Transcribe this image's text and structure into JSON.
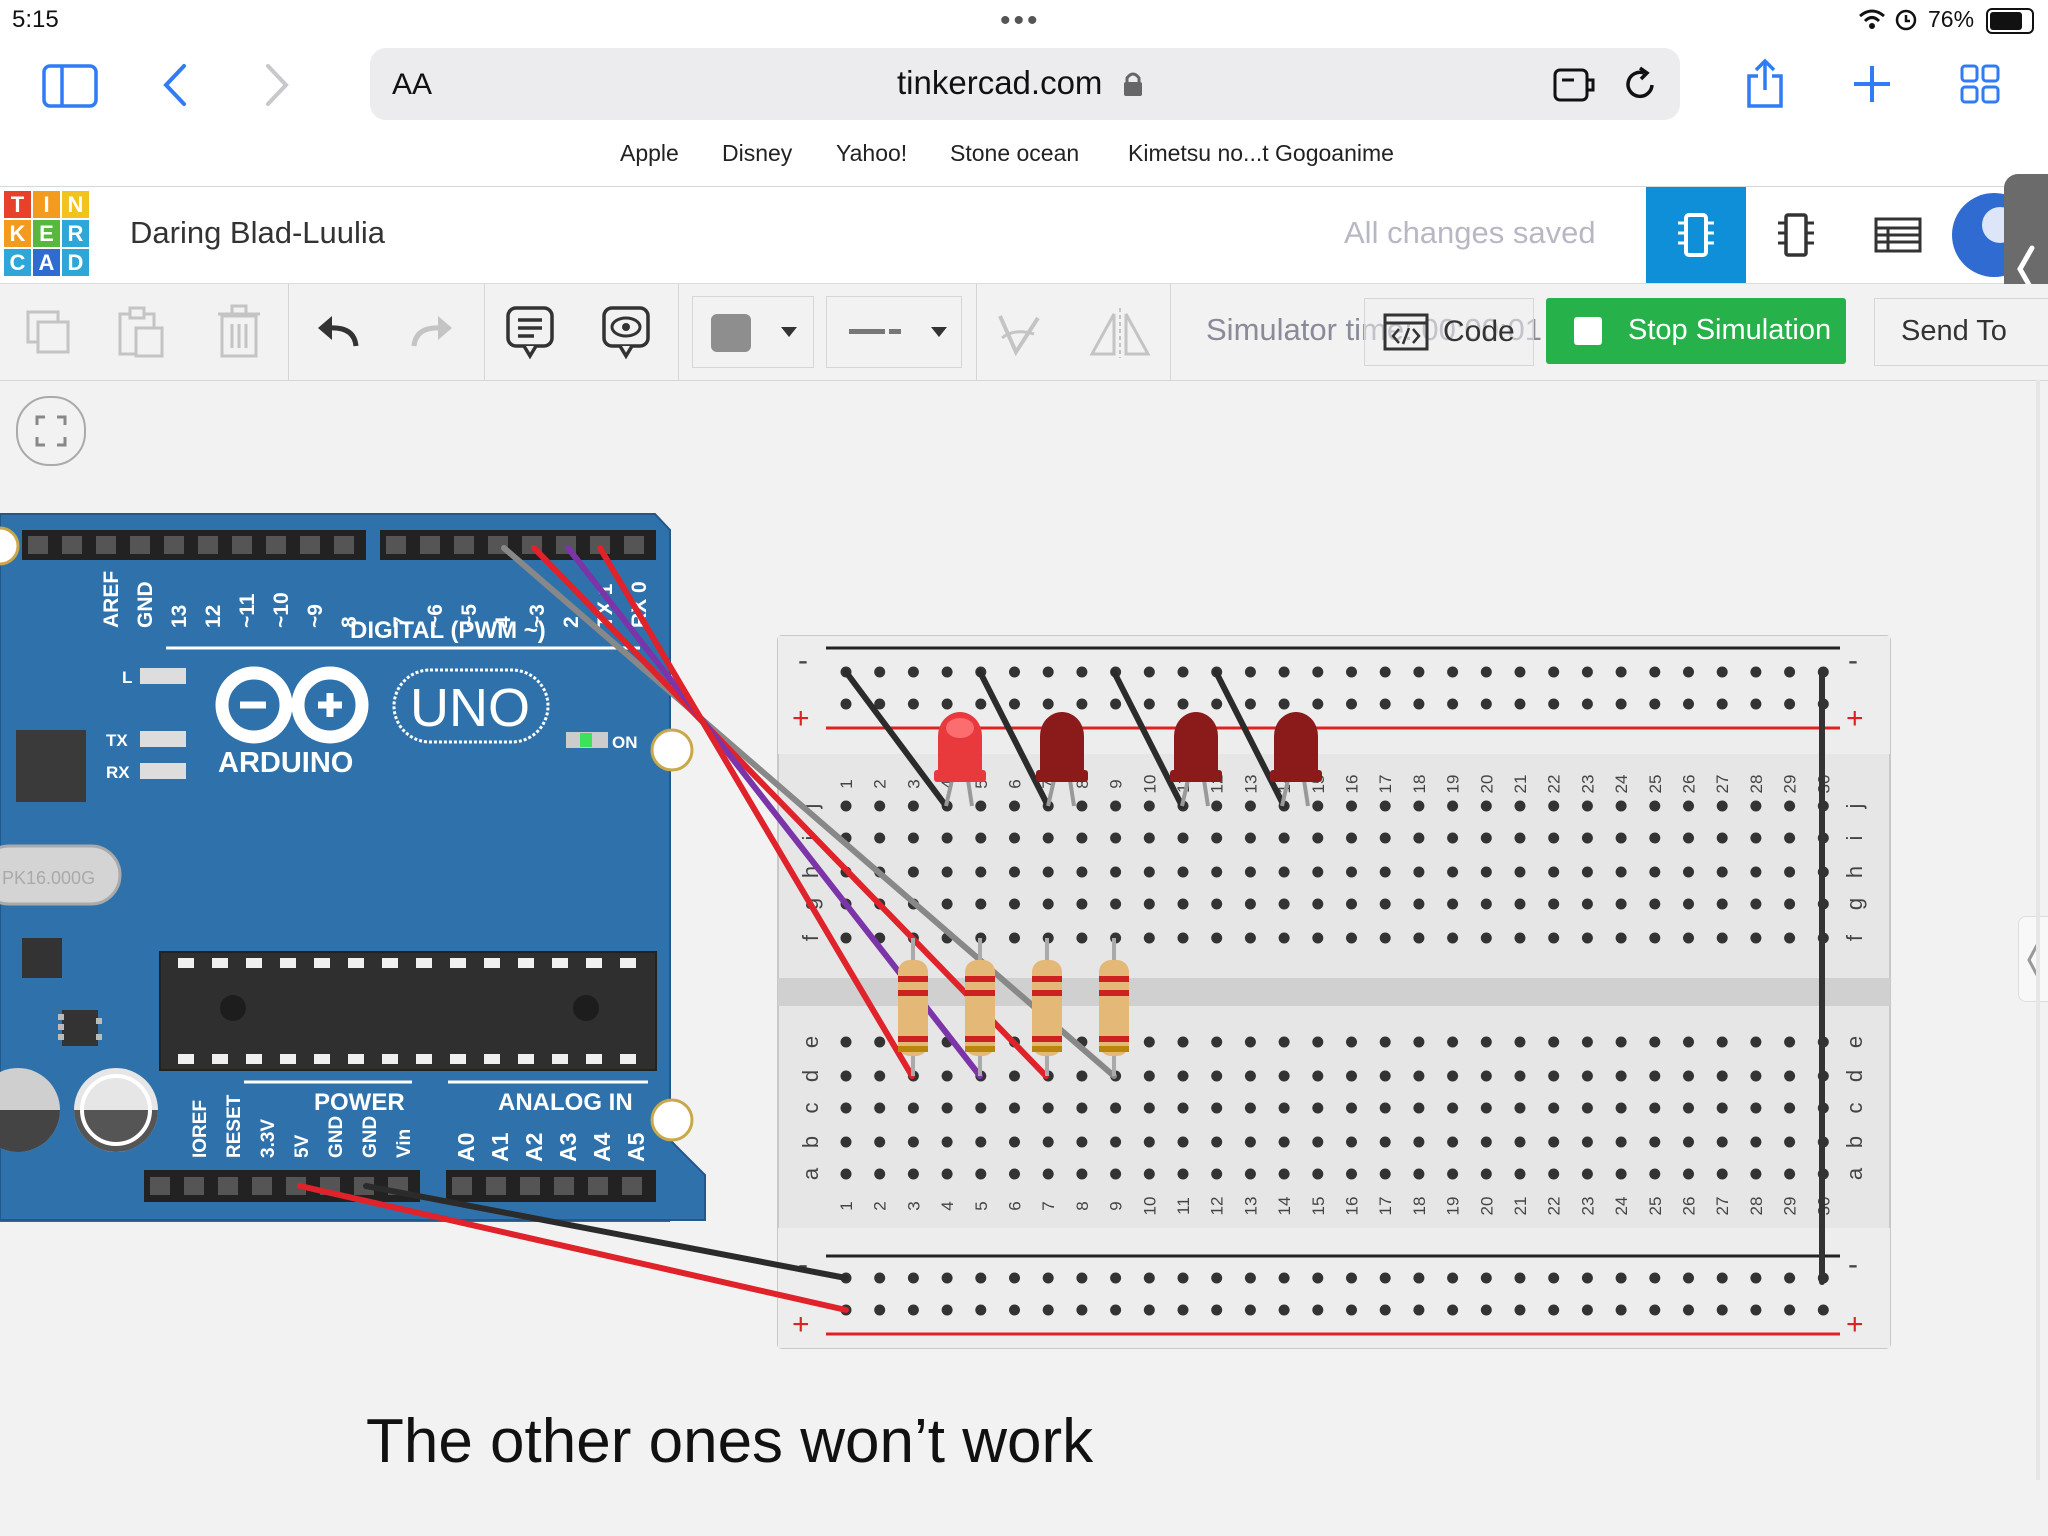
{
  "status_bar": {
    "time": "5:15",
    "battery": "76%"
  },
  "browser": {
    "text_size_label": "AA",
    "url": "tinkercad.com",
    "favorites": [
      "Apple",
      "Disney",
      "Yahoo!",
      "Stone ocean",
      "Kimetsu no...t Gogoanime"
    ]
  },
  "tinkercad": {
    "logo_letters": [
      "T",
      "I",
      "N",
      "K",
      "E",
      "R",
      "C",
      "A",
      "D"
    ],
    "project_title": "Daring Blad-Luulia",
    "save_status": "All changes saved",
    "toolbar": {
      "simulator_timer": "Simulator time: 00:00:01",
      "code_label": "Code",
      "stop_simulation_label": "Stop Simulation",
      "send_to_label": "Send To"
    }
  },
  "arduino": {
    "brand": "ARDUINO",
    "model": "UNO",
    "digital_header_label": "DIGITAL (PWM ~)",
    "digital_pins": [
      "AREF",
      "GND",
      "13",
      "12",
      "~11",
      "~10",
      "~9",
      "8",
      "7",
      "~6",
      "~5",
      "4",
      "~3",
      "2",
      "TX 1",
      "RX 0"
    ],
    "led_labels": [
      "L",
      "TX",
      "RX"
    ],
    "on_label": "ON",
    "crystal_label": "PK16.000G",
    "power_label": "POWER",
    "analog_label": "ANALOG IN",
    "power_pins": [
      "IOREF",
      "RESET",
      "3.3V",
      "5V",
      "GND",
      "GND",
      "Vin"
    ],
    "analog_pins": [
      "A0",
      "A1",
      "A2",
      "A3",
      "A4",
      "A5"
    ]
  },
  "breadboard": {
    "columns": 30,
    "rows_top": [
      "j",
      "i",
      "h",
      "g",
      "f"
    ],
    "rows_bottom": [
      "e",
      "d",
      "c",
      "b",
      "a"
    ],
    "rail_labels": [
      "-",
      "+"
    ]
  },
  "caption": "The other ones won’t work"
}
